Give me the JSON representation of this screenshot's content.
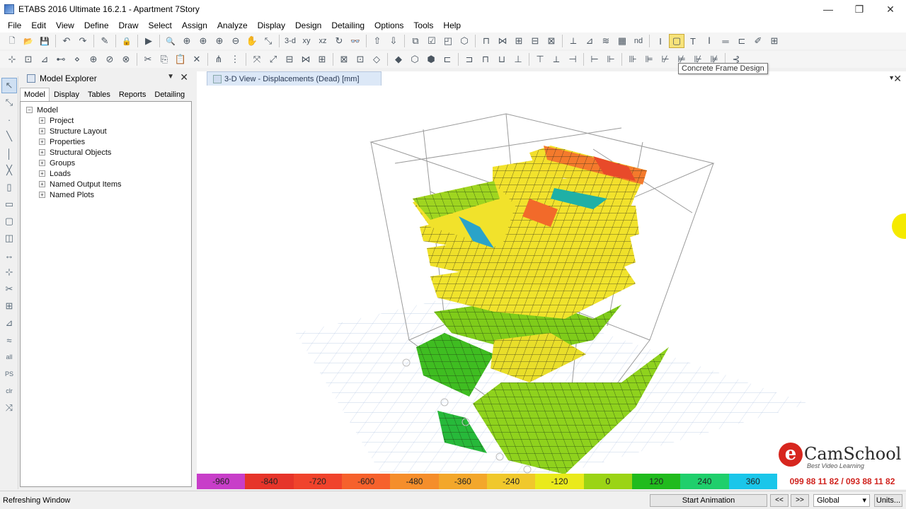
{
  "window": {
    "title": "ETABS 2016 Ultimate 16.2.1 - Apartment 7Story",
    "controls": [
      "—",
      "❐",
      "✕"
    ]
  },
  "menu": [
    "File",
    "Edit",
    "View",
    "Define",
    "Draw",
    "Select",
    "Assign",
    "Analyze",
    "Display",
    "Design",
    "Detailing",
    "Options",
    "Tools",
    "Help"
  ],
  "toolbar": {
    "row1": [
      {
        "name": "new-model-icon",
        "glyph": "🗋"
      },
      {
        "name": "open-icon",
        "glyph": "📂"
      },
      {
        "name": "save-icon",
        "glyph": "💾"
      },
      {
        "name": "sep"
      },
      {
        "name": "undo-icon",
        "glyph": "↶"
      },
      {
        "name": "redo-icon",
        "glyph": "↷"
      },
      {
        "name": "sep"
      },
      {
        "name": "edit-pencil-icon",
        "glyph": "✎"
      },
      {
        "name": "sep"
      },
      {
        "name": "lock-icon",
        "glyph": "🔒"
      },
      {
        "name": "sep"
      },
      {
        "name": "run-analysis-icon",
        "glyph": "▶"
      },
      {
        "name": "sep"
      },
      {
        "name": "zoom-window-icon",
        "glyph": "🔍"
      },
      {
        "name": "zoom-restore-icon",
        "glyph": "⊕"
      },
      {
        "name": "zoom-in-icon",
        "glyph": "⊕"
      },
      {
        "name": "zoom-in-step-icon",
        "glyph": "⊕"
      },
      {
        "name": "zoom-out-icon",
        "glyph": "⊖"
      },
      {
        "name": "pan-icon",
        "glyph": "✋"
      },
      {
        "name": "rubber-band-icon",
        "glyph": "⤡"
      },
      {
        "name": "sep"
      },
      {
        "name": "view-3d-button",
        "glyph": "3-d"
      },
      {
        "name": "plan-view-icon",
        "glyph": "xy"
      },
      {
        "name": "elevation-view-icon",
        "glyph": "xz"
      },
      {
        "name": "rotate-view-icon",
        "glyph": "↻"
      },
      {
        "name": "perspective-icon",
        "glyph": "👓"
      },
      {
        "name": "sep"
      },
      {
        "name": "move-up-icon",
        "glyph": "⇧"
      },
      {
        "name": "move-down-icon",
        "glyph": "⇩"
      },
      {
        "name": "sep"
      },
      {
        "name": "object-shrink-icon",
        "glyph": "⧉"
      },
      {
        "name": "set-display-options-icon",
        "glyph": "☑"
      },
      {
        "name": "show-undeformed-icon",
        "glyph": "◰"
      },
      {
        "name": "show-loads-icon",
        "glyph": "⬡"
      },
      {
        "name": "sep"
      },
      {
        "name": "draw-frame-icon",
        "glyph": "⊓"
      },
      {
        "name": "draw-brace-icon",
        "glyph": "⋈"
      },
      {
        "name": "draw-floor-icon",
        "glyph": "⊞"
      },
      {
        "name": "draw-wall-icon",
        "glyph": "⊟"
      },
      {
        "name": "draw-opening-icon",
        "glyph": "⊠"
      },
      {
        "name": "sep"
      },
      {
        "name": "show-forces-icon",
        "glyph": "⟂"
      },
      {
        "name": "show-shells-icon",
        "glyph": "⊿"
      },
      {
        "name": "show-moments-icon",
        "glyph": "≋"
      },
      {
        "name": "show-tables-icon",
        "glyph": "▦"
      },
      {
        "name": "nd-icon",
        "glyph": "nd"
      },
      {
        "name": "sep"
      },
      {
        "name": "steel-frame-design-icon",
        "glyph": "I"
      },
      {
        "name": "concrete-frame-design-button",
        "glyph": "▢",
        "highlight": true
      },
      {
        "name": "composite-beam-design-icon",
        "glyph": "T"
      },
      {
        "name": "steel-joist-design-icon",
        "glyph": "Ⅰ"
      },
      {
        "name": "shear-wall-design-icon",
        "glyph": "═"
      },
      {
        "name": "slab-design-icon",
        "glyph": "⊏"
      },
      {
        "name": "pen-tool-icon",
        "glyph": "✐"
      },
      {
        "name": "detailing-icon",
        "glyph": "⊞"
      }
    ],
    "row2": [
      "snap-points-icon",
      "snap-grid-icon",
      "snap-ends-icon",
      "snap-midpoint-icon",
      "snap-intersect-icon",
      "snap-perp-icon",
      "snap-lines-icon",
      "snap-fine-icon",
      "sep",
      "cut-icon",
      "copy-icon",
      "paste-icon",
      "delete-icon",
      "sep",
      "select-all-icon",
      "select-get-previous-icon",
      "sep",
      "assign-joint-icon",
      "assign-frame-icon",
      "assign-shell-icon",
      "assign-link-icon",
      "assign-tendon-icon",
      "sep",
      "assign-load-icon",
      "assign-diaphragm-icon",
      "assign-restraint-icon",
      "sep",
      "display-frame-icon",
      "display-shell-icon",
      "display-link-icon",
      "display-tendon-icon",
      "sep",
      "forces-axial-icon",
      "forces-shear-icon",
      "forces-moment-icon",
      "forces-torsion-icon",
      "sep",
      "story-drift-icon",
      "mode-shape-icon",
      "deformed-shape-icon",
      "sep",
      "pier-label-icon",
      "spandrel-label-icon",
      "sep",
      "wall-stack-icon",
      "slab-strip-icon",
      "section-cut-icon",
      "close-all-icon",
      "tendon-icon",
      "curve-icon",
      "sep",
      "legend-icon"
    ]
  },
  "tooltip": "Concrete Frame Design",
  "left_tools": [
    "pointer-icon",
    "reshape-icon",
    "draw-joint-icon",
    "draw-beam-icon",
    "draw-column-icon",
    "draw-brace-tool-icon",
    "draw-wall-tool-icon",
    "draw-floor-tool-icon",
    "draw-rect-floor-icon",
    "draw-opening-tool-icon",
    "draw-dim-icon",
    "draw-reference-icon",
    "draw-section-cut-icon",
    "draw-grid-icon",
    "draw-ramp-icon",
    "draw-null-icon",
    "select-all-tool-icon",
    "select-ps-icon",
    "clear-selection-icon",
    "snap-tool-icon"
  ],
  "explorer": {
    "title": "Model Explorer",
    "tabs": [
      "Model",
      "Display",
      "Tables",
      "Reports",
      "Detailing"
    ],
    "active_tab": "Model",
    "root": "Model",
    "items": [
      "Project",
      "Structure Layout",
      "Properties",
      "Structural Objects",
      "Groups",
      "Loads",
      "Named Output Items",
      "Named Plots"
    ]
  },
  "view": {
    "tab_title": "3-D View  - Displacements (Dead)  [mm]"
  },
  "legend": {
    "values": [
      "-960",
      "-840",
      "-720",
      "-600",
      "-480",
      "-360",
      "-240",
      "-120",
      "0",
      "120",
      "240",
      "360"
    ],
    "colors": [
      "#c83ec9",
      "#e6342a",
      "#f0432c",
      "#f6612c",
      "#f58e2b",
      "#f3a72b",
      "#f0c82c",
      "#eaea1c",
      "#9bd415",
      "#20bb1d",
      "#1fcf6c",
      "#1ac6ea"
    ]
  },
  "branding": {
    "logo_letter": "e",
    "logo_name": "CamSchool",
    "tagline": "Best Video Learning",
    "phone": "099 88 11 82 / 093 88 11 82"
  },
  "status": {
    "message": "Refreshing Window",
    "start_animation": "Start Animation",
    "prev": "<<",
    "next": ">>",
    "coord_system": "Global",
    "units": "Units..."
  }
}
